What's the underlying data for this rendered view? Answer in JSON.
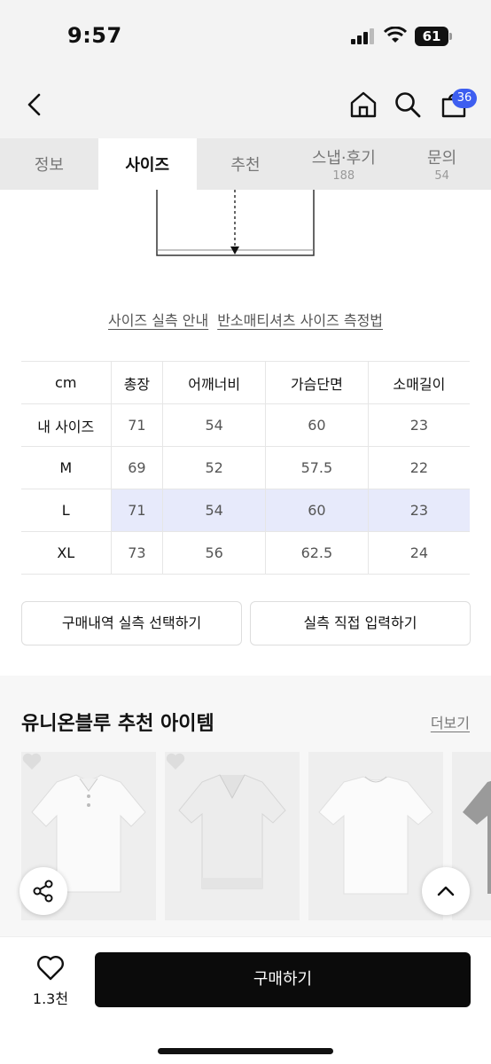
{
  "status_bar": {
    "time": "9:57",
    "battery": "61"
  },
  "header": {
    "cart_count": "36"
  },
  "tabs": [
    {
      "label": "정보",
      "sub": ""
    },
    {
      "label": "사이즈",
      "sub": ""
    },
    {
      "label": "추천",
      "sub": ""
    },
    {
      "label": "스냅·후기",
      "sub": "188"
    },
    {
      "label": "문의",
      "sub": "54"
    }
  ],
  "links": {
    "size_guide": "사이즈 실측 안내",
    "category_guide": "반소매티셔츠 사이즈 측정법"
  },
  "size_table": {
    "headers": [
      "cm",
      "총장",
      "어깨너비",
      "가슴단면",
      "소매길이"
    ],
    "rows": [
      [
        "내 사이즈",
        "71",
        "54",
        "60",
        "23"
      ],
      [
        "M",
        "69",
        "52",
        "57.5",
        "22"
      ],
      [
        "L",
        "71",
        "54",
        "60",
        "23"
      ],
      [
        "XL",
        "73",
        "56",
        "62.5",
        "24"
      ]
    ],
    "highlight_color": "#e7eafb"
  },
  "buttons": {
    "select_purchase": "구매내역 실측 선택하기",
    "direct_input": "실측 직접 입력하기"
  },
  "recommend": {
    "title": "유니온블루 추천 아이템",
    "more": "더보기"
  },
  "bottom": {
    "like_count": "1.3천",
    "buy_label": "구매하기"
  },
  "colors": {
    "accent": "#3d5ef0",
    "buy_bg": "#0b0b0b"
  }
}
